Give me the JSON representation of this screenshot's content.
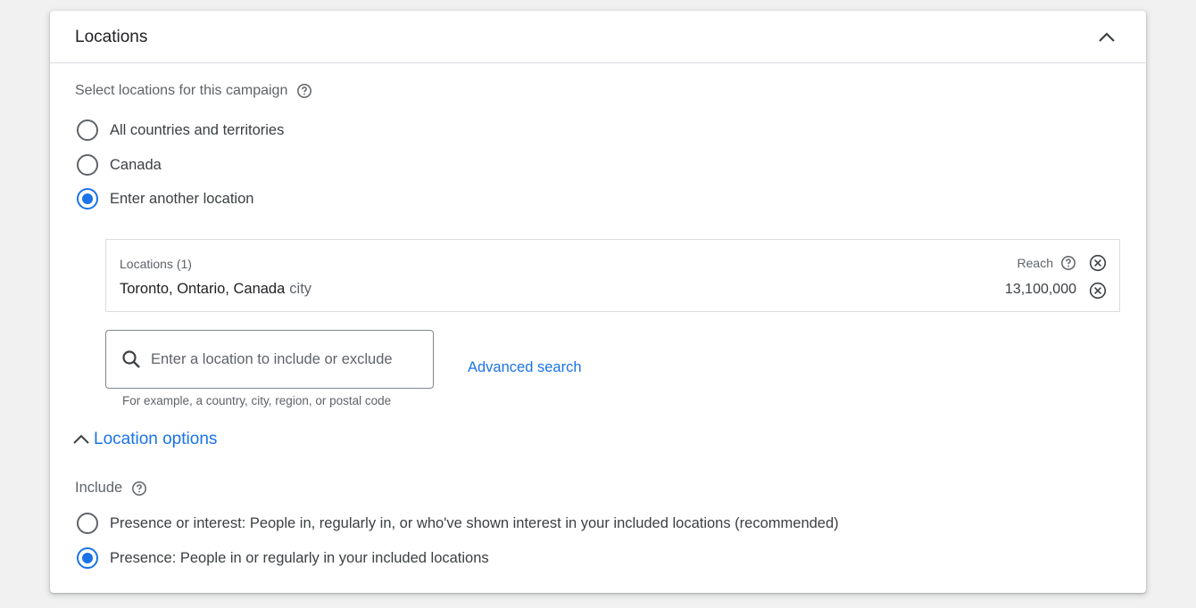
{
  "card": {
    "title": "Locations"
  },
  "select_label": "Select locations for this campaign",
  "location_radios": [
    {
      "label": "All countries and territories",
      "checked": false
    },
    {
      "label": "Canada",
      "checked": false
    },
    {
      "label": "Enter another location",
      "checked": true
    }
  ],
  "locations_box": {
    "header": "Locations (1)",
    "reach_label": "Reach",
    "items": [
      {
        "name": "Toronto, Ontario, Canada",
        "type": "city",
        "reach": "13,100,000"
      }
    ]
  },
  "search": {
    "placeholder": "Enter a location to include or exclude",
    "value": "",
    "hint": "For example, a country, city, region, or postal code"
  },
  "advanced_search": "Advanced search",
  "location_options": {
    "label": "Location options",
    "expanded": true,
    "include_label": "Include",
    "radios": [
      {
        "label": "Presence or interest: People in, regularly in, or who've shown interest in your included locations (recommended)",
        "checked": false
      },
      {
        "label": "Presence: People in or regularly in your included locations",
        "checked": true
      }
    ]
  },
  "colors": {
    "accent": "#1a73e8",
    "text": "#3c4043",
    "secondary_text": "#5f6368",
    "border": "#dadce0",
    "background": "#f1f1f1"
  },
  "icons": [
    "chevron-up-icon",
    "help-icon",
    "cancel-circle-icon",
    "search-icon"
  ]
}
